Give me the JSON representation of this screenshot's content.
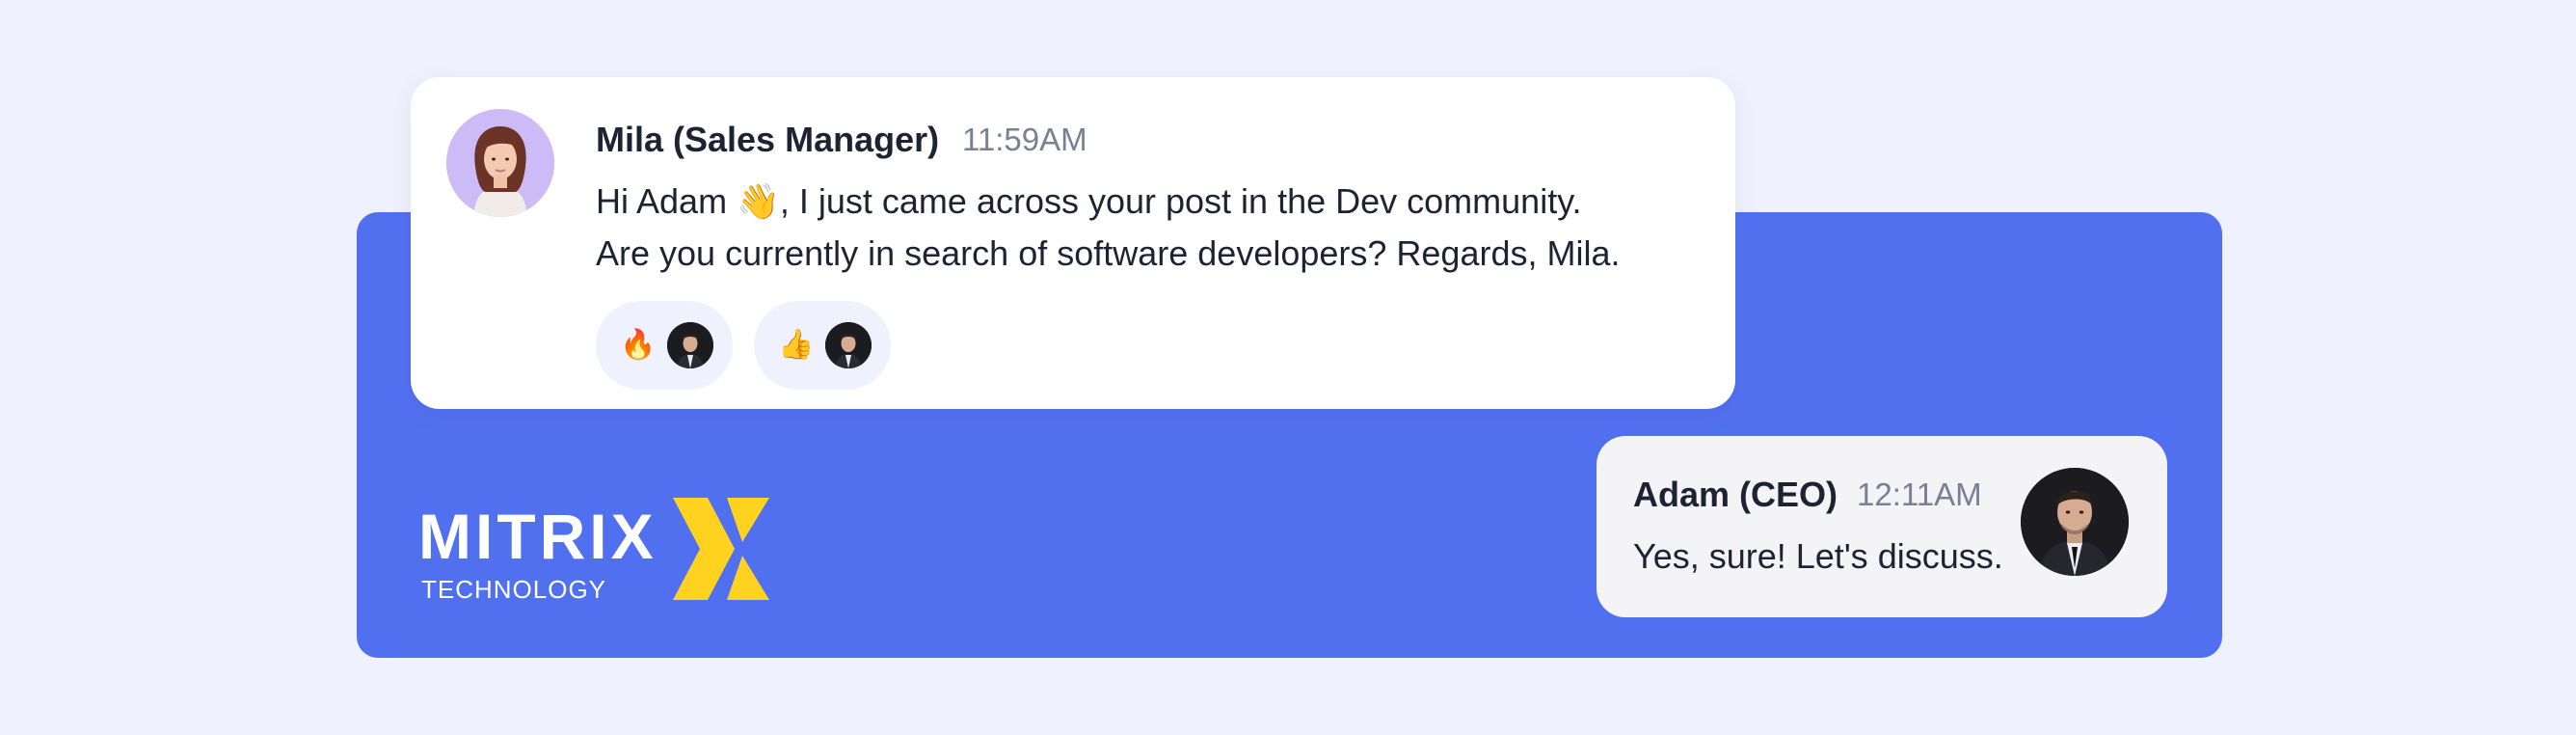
{
  "messages": [
    {
      "author": "Mila (Sales Manager)",
      "time": "11:59AM",
      "text_line1": "Hi Adam 👋,  I just came across your post in the Dev community.",
      "text_line2": "Are you currently in search of software developers? Regards, Mila.",
      "reactions": [
        {
          "emoji": "🔥",
          "icon": "fire-icon"
        },
        {
          "emoji": "👍",
          "icon": "thumbs-up-icon"
        }
      ]
    },
    {
      "author": "Adam (CEO)",
      "time": "12:11AM",
      "text": "Yes, sure!  Let's discuss."
    }
  ],
  "brand": {
    "name": "MITRIX",
    "subtitle": "TECHNOLOGY",
    "logo_icon": "x-chevron-logo",
    "colors": {
      "panel": "#5170f0",
      "page": "#eff1fe",
      "logo_mark": "#ffd21f"
    }
  }
}
